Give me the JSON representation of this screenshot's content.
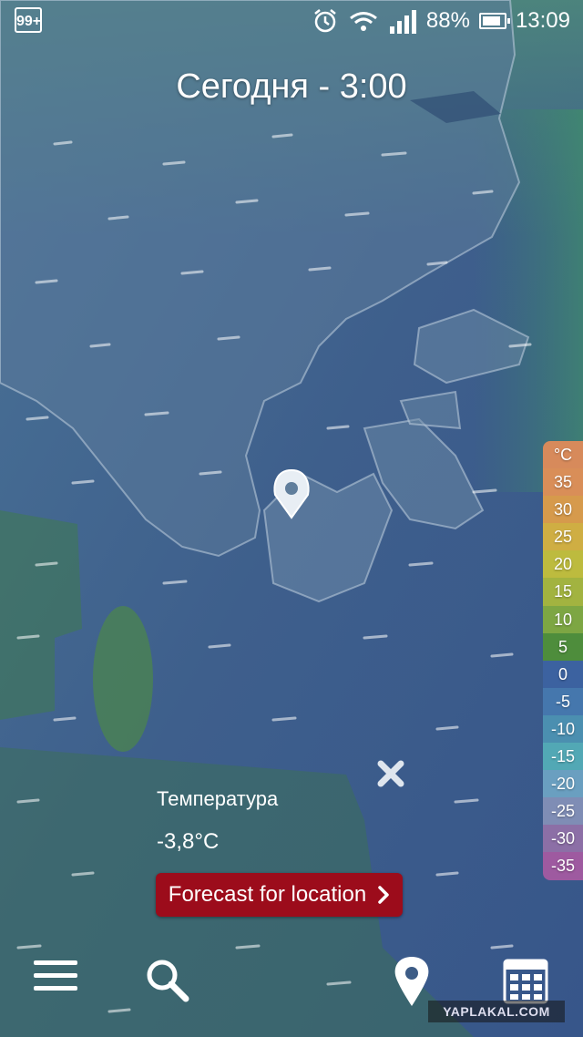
{
  "status_bar": {
    "notification_badge": "99+",
    "battery_percent": "88%",
    "battery_level": 0.88,
    "time": "13:09",
    "icons": [
      "alarm-icon",
      "wifi-icon",
      "signal-icon",
      "battery-icon"
    ]
  },
  "map": {
    "title": "Сегодня - 3:00",
    "pin_icon": "location-pin-icon"
  },
  "legend": {
    "unit": "°C",
    "entries": [
      {
        "label": "35",
        "color": "#d98e58"
      },
      {
        "label": "30",
        "color": "#d69a4c"
      },
      {
        "label": "25",
        "color": "#cfae43"
      },
      {
        "label": "20",
        "color": "#bdbb3e"
      },
      {
        "label": "15",
        "color": "#a2b340"
      },
      {
        "label": "10",
        "color": "#7da643"
      },
      {
        "label": "5",
        "color": "#4e8d3c"
      },
      {
        "label": "0",
        "color": "#3c62a0"
      },
      {
        "label": "-5",
        "color": "#4577ad"
      },
      {
        "label": "-10",
        "color": "#4b8fb0"
      },
      {
        "label": "-15",
        "color": "#52a8b5"
      },
      {
        "label": "-20",
        "color": "#6a9fc0"
      },
      {
        "label": "-25",
        "color": "#7f8db5"
      },
      {
        "label": "-30",
        "color": "#8c6fa6"
      },
      {
        "label": "-35",
        "color": "#9e5aa0"
      }
    ]
  },
  "info": {
    "label": "Температура",
    "value": "-3,8°C",
    "close_icon": "close-icon"
  },
  "forecast_button": {
    "label": "Forecast for location",
    "icon": "chevron-right-icon",
    "color": "#9c0c1b"
  },
  "toolbar": {
    "icons": [
      "menu-icon",
      "search-icon",
      "location-pin-icon",
      "calendar-grid-icon"
    ]
  },
  "watermark": "YAPLAKAL.COM"
}
